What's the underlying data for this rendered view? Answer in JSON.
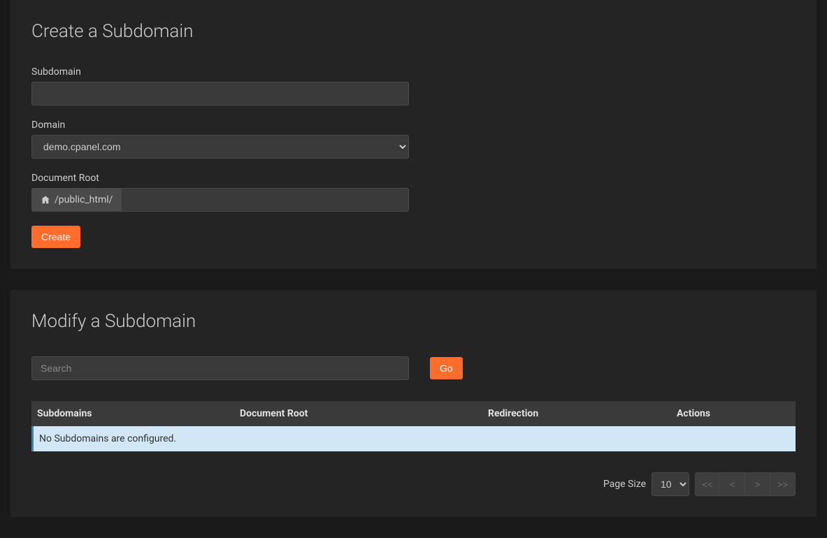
{
  "create": {
    "title": "Create a Subdomain",
    "subdomain_label": "Subdomain",
    "subdomain_value": "",
    "domain_label": "Domain",
    "domain_selected": "demo.cpanel.com",
    "docroot_label": "Document Root",
    "docroot_prefix": "/public_html/",
    "docroot_value": "",
    "create_button": "Create"
  },
  "modify": {
    "title": "Modify a Subdomain",
    "search_placeholder": "Search",
    "search_value": "",
    "go_button": "Go",
    "columns": {
      "subdomains": "Subdomains",
      "docroot": "Document Root",
      "redirection": "Redirection",
      "actions": "Actions"
    },
    "empty_message": "No Subdomains are configured.",
    "pagination": {
      "page_size_label": "Page Size",
      "page_size_value": "10",
      "first": "<<",
      "prev": "<",
      "next": ">",
      "last": ">>"
    }
  }
}
